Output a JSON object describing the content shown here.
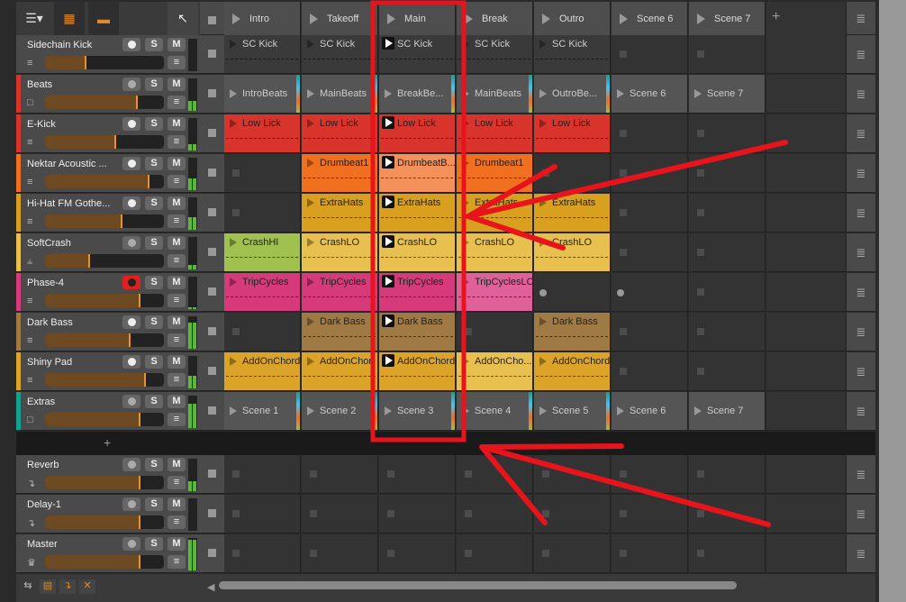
{
  "toolbar": {
    "tools": [
      "list-view-icon",
      "grid-view-icon",
      "rows-view-icon",
      "pointer-icon"
    ],
    "stop_all": "stop-icon",
    "add_scene": "+"
  },
  "scenes": [
    "Intro",
    "Takeoff",
    "Main",
    "Break",
    "Outro",
    "Scene 6",
    "Scene 7"
  ],
  "tracks": [
    {
      "name": "Sidechain Kick",
      "icon": "piano-icon",
      "color": "#4a4a4a",
      "vol": 0.35,
      "arm": "white",
      "meter": 0,
      "clips": [
        [
          "SC Kick",
          "#555"
        ],
        [
          "SC Kick",
          "#555"
        ],
        [
          "SC Kick",
          "#555",
          1
        ],
        [
          "SC Kick",
          "#555"
        ],
        [
          "SC Kick",
          "#555"
        ],
        null,
        null
      ]
    },
    {
      "name": "Beats",
      "icon": "folder-icon",
      "color": "#d9342b",
      "vol": 0.78,
      "arm": "gray",
      "meter": 0.3,
      "group": true,
      "clips": [
        [
          "IntroBeats"
        ],
        [
          "MainBeats"
        ],
        [
          "BreakBe...",
          null,
          1
        ],
        [
          "MainBeats"
        ],
        [
          "OutroBe..."
        ],
        [
          "Scene 6"
        ],
        [
          "Scene 7"
        ]
      ]
    },
    {
      "name": "E-Kick",
      "icon": "piano-icon",
      "color": "#d9342b",
      "vol": 0.6,
      "arm": "white",
      "meter": 0.2,
      "clips": [
        [
          "Low Lick",
          "#d9342b"
        ],
        [
          "Low Lick",
          "#d9342b"
        ],
        [
          "Low Lick",
          "#d9342b",
          1
        ],
        [
          "Low Lick",
          "#d9342b"
        ],
        [
          "Low Lick",
          "#d9342b"
        ],
        null,
        null
      ]
    },
    {
      "name": "Nektar Acoustic ...",
      "icon": "piano-icon",
      "color": "#f07020",
      "vol": 0.88,
      "arm": "white",
      "meter": 0.35,
      "clips": [
        null,
        [
          "Drumbeat1",
          "#f07020"
        ],
        [
          "DrumbeatB...",
          "#f4905a",
          1
        ],
        [
          "Drumbeat1",
          "#f07020"
        ],
        null,
        null,
        null
      ]
    },
    {
      "name": "Hi-Hat FM Gothe...",
      "icon": "piano-icon",
      "color": "#d9a020",
      "vol": 0.65,
      "arm": "white",
      "meter": 0.4,
      "clips": [
        null,
        [
          "ExtraHats",
          "#d9a020"
        ],
        [
          "ExtraHats",
          "#d9a020",
          1
        ],
        [
          "ExtraHats",
          "#d9a020"
        ],
        [
          "ExtraHats",
          "#d9a020"
        ],
        null,
        null
      ]
    },
    {
      "name": "SoftCrash",
      "icon": "waveform-icon",
      "color": "#e8c050",
      "vol": 0.38,
      "arm": "gray",
      "meter": 0.15,
      "clips": [
        [
          "CrashHI",
          "#a0c050"
        ],
        [
          "CrashLO",
          "#e8c050"
        ],
        [
          "CrashLO",
          "#e8c050",
          1
        ],
        [
          "CrashLO",
          "#e8c050"
        ],
        [
          "CrashLO",
          "#e8c050"
        ],
        null,
        null
      ]
    },
    {
      "name": "Phase-4",
      "icon": "piano-icon",
      "color": "#d63a7a",
      "vol": 0.8,
      "arm": "red",
      "meter": 0.05,
      "clips": [
        [
          "TripCycles",
          "#d63a7a"
        ],
        [
          "TripCycles",
          "#d63a7a"
        ],
        [
          "TripCycles",
          "#d63a7a",
          1
        ],
        [
          "TripCyclesLO",
          "#e0609a"
        ],
        "rec",
        "rec",
        null
      ]
    },
    {
      "name": "Dark Bass",
      "icon": "piano-icon",
      "color": "#a07a45",
      "vol": 0.72,
      "arm": "white",
      "meter": 0.8,
      "clips": [
        null,
        [
          "Dark Bass",
          "#a07a45"
        ],
        [
          "Dark Bass",
          "#a07a45",
          1
        ],
        null,
        [
          "Dark Bass",
          "#a07a45"
        ],
        null,
        null
      ]
    },
    {
      "name": "Shiny Pad",
      "icon": "piano-icon",
      "color": "#dba428",
      "vol": 0.85,
      "arm": "white",
      "meter": 0.4,
      "clips": [
        [
          "AddOnChord",
          "#dba428"
        ],
        [
          "AddOnChor",
          "#dba428"
        ],
        [
          "AddOnChord",
          "#dba428",
          1
        ],
        [
          "AddOnCho...",
          "#e8c050"
        ],
        [
          "AddOnChord",
          "#dba428"
        ],
        null,
        null
      ]
    },
    {
      "name": "Extras",
      "icon": "folder-icon",
      "color": "#16a090",
      "vol": 0.8,
      "arm": "gray",
      "meter": 0.75,
      "group": true,
      "clips": [
        [
          "Scene 1"
        ],
        [
          "Scene 2"
        ],
        [
          "Scene 3",
          null,
          1
        ],
        [
          "Scene 4"
        ],
        [
          "Scene 5"
        ],
        [
          "Scene 6"
        ],
        [
          "Scene 7"
        ]
      ]
    }
  ],
  "add_track": "+",
  "fx_tracks": [
    {
      "name": "Reverb",
      "icon": "return-icon",
      "vol": 0.8,
      "meter": 0.3
    },
    {
      "name": "Delay-1",
      "icon": "return-icon",
      "vol": 0.8,
      "meter": 0
    },
    {
      "name": "Master",
      "icon": "crown-icon",
      "vol": 0.8,
      "meter": 0.95
    }
  ],
  "buttons": {
    "solo": "S",
    "mute": "M"
  },
  "annotation_color": "#e8141c"
}
